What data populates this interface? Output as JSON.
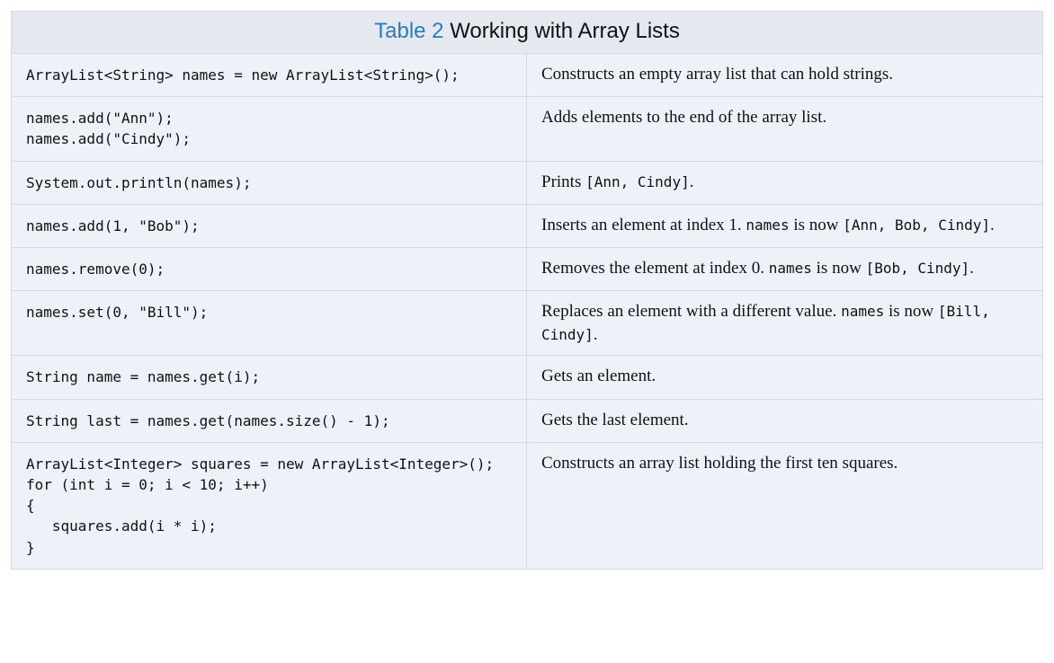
{
  "table": {
    "title_label": "Table 2",
    "title_text": "Working with Array Lists",
    "rows": [
      {
        "code": "ArrayList<String> names = new ArrayList<String>();",
        "desc_pre": "Constructs an empty array list that can hold strings.",
        "code_inline1": "",
        "desc_mid": "",
        "code_inline2": "",
        "desc_post": ""
      },
      {
        "code": "names.add(\"Ann\");\nnames.add(\"Cindy\");",
        "desc_pre": "Adds elements to the end of the array list.",
        "code_inline1": "",
        "desc_mid": "",
        "code_inline2": "",
        "desc_post": ""
      },
      {
        "code": "System.out.println(names);",
        "desc_pre": "Prints ",
        "code_inline1": "[Ann, Cindy]",
        "desc_mid": ".",
        "code_inline2": "",
        "desc_post": ""
      },
      {
        "code": "names.add(1, \"Bob\");",
        "desc_pre": "Inserts an element at index 1. ",
        "code_inline1": "names",
        "desc_mid": " is now ",
        "code_inline2": "[Ann, Bob, Cindy]",
        "desc_post": "."
      },
      {
        "code": "names.remove(0);",
        "desc_pre": "Removes the element at index 0. ",
        "code_inline1": "names",
        "desc_mid": " is now ",
        "code_inline2": "[Bob, Cindy]",
        "desc_post": "."
      },
      {
        "code": "names.set(0, \"Bill\");",
        "desc_pre": "Replaces an element with a different value. ",
        "code_inline1": "names",
        "desc_mid": " is now ",
        "code_inline2": "[Bill, Cindy]",
        "desc_post": "."
      },
      {
        "code": "String name = names.get(i);",
        "desc_pre": "Gets an element.",
        "code_inline1": "",
        "desc_mid": "",
        "code_inline2": "",
        "desc_post": ""
      },
      {
        "code": "String last = names.get(names.size() - 1);",
        "desc_pre": "Gets the last element.",
        "code_inline1": "",
        "desc_mid": "",
        "code_inline2": "",
        "desc_post": ""
      },
      {
        "code": "ArrayList<Integer> squares = new ArrayList<Integer>();\nfor (int i = 0; i < 10; i++)\n{\n   squares.add(i * i);\n}",
        "desc_pre": "Constructs an array list holding the first ten squares.",
        "code_inline1": "",
        "desc_mid": "",
        "code_inline2": "",
        "desc_post": ""
      }
    ]
  }
}
